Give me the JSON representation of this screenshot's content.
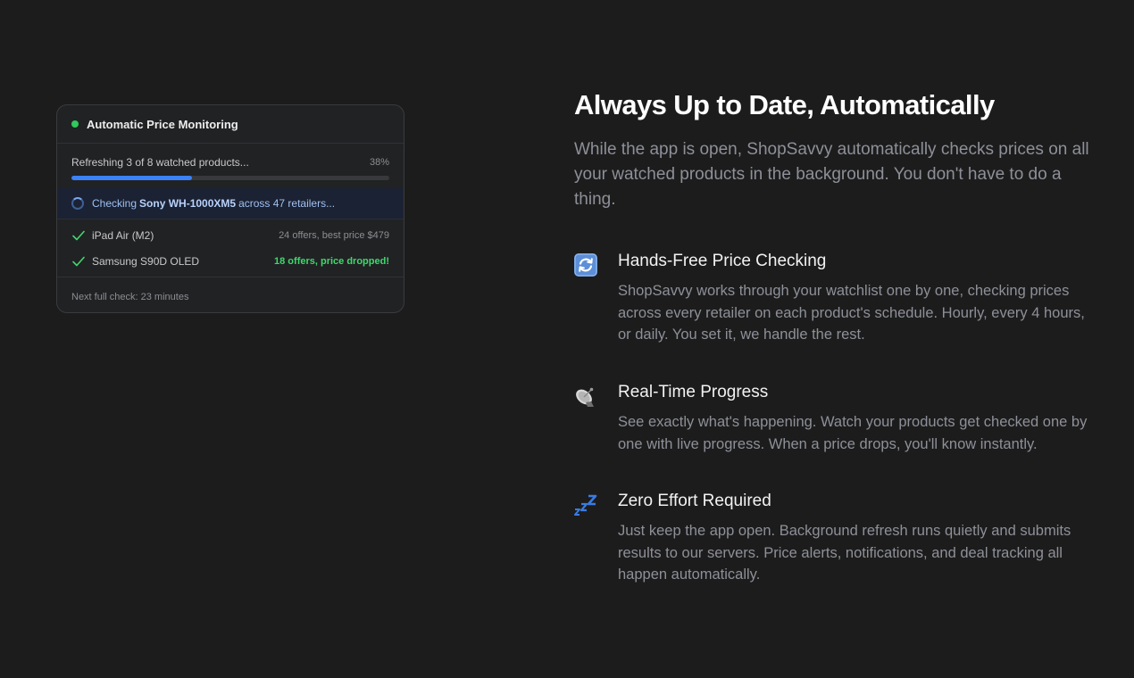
{
  "monitor": {
    "title": "Automatic Price Monitoring",
    "progress_text": "Refreshing 3 of 8 watched products...",
    "progress_pct": "38%",
    "progress_fraction": 0.38,
    "checking_prefix": "Checking",
    "checking_product": "Sony WH-1000XM5",
    "checking_suffix": "across 47 retailers...",
    "items": [
      {
        "name": "iPad Air (M2)",
        "meta": "24 offers, best price $479",
        "highlight": false
      },
      {
        "name": "Samsung S90D OLED",
        "meta": "18 offers, price dropped!",
        "highlight": true
      }
    ],
    "footer": "Next full check: 23 minutes"
  },
  "hero": {
    "title": "Always Up to Date, Automatically",
    "description": "While the app is open, ShopSavvy automatically checks prices on all your watched products in the background. You don't have to do a thing."
  },
  "features": [
    {
      "icon": "refresh-icon",
      "title": "Hands-Free Price Checking",
      "description": "ShopSavvy works through your watchlist one by one, checking prices across every retailer on each product's schedule. Hourly, every 4 hours, or daily. You set it, we handle the rest."
    },
    {
      "icon": "satellite-dish-icon",
      "title": "Real-Time Progress",
      "description": "See exactly what's happening. Watch your products get checked one by one with live progress. When a price drops, you'll know instantly."
    },
    {
      "icon": "zzz-icon",
      "title": "Zero Effort Required",
      "description": "Just keep the app open. Background refresh runs quietly and submits results to our servers. Price alerts, notifications, and deal tracking all happen automatically."
    }
  ],
  "colors": {
    "background": "#1c1c1c",
    "accent_blue": "#3b82f6",
    "success_green": "#3fd96c"
  }
}
